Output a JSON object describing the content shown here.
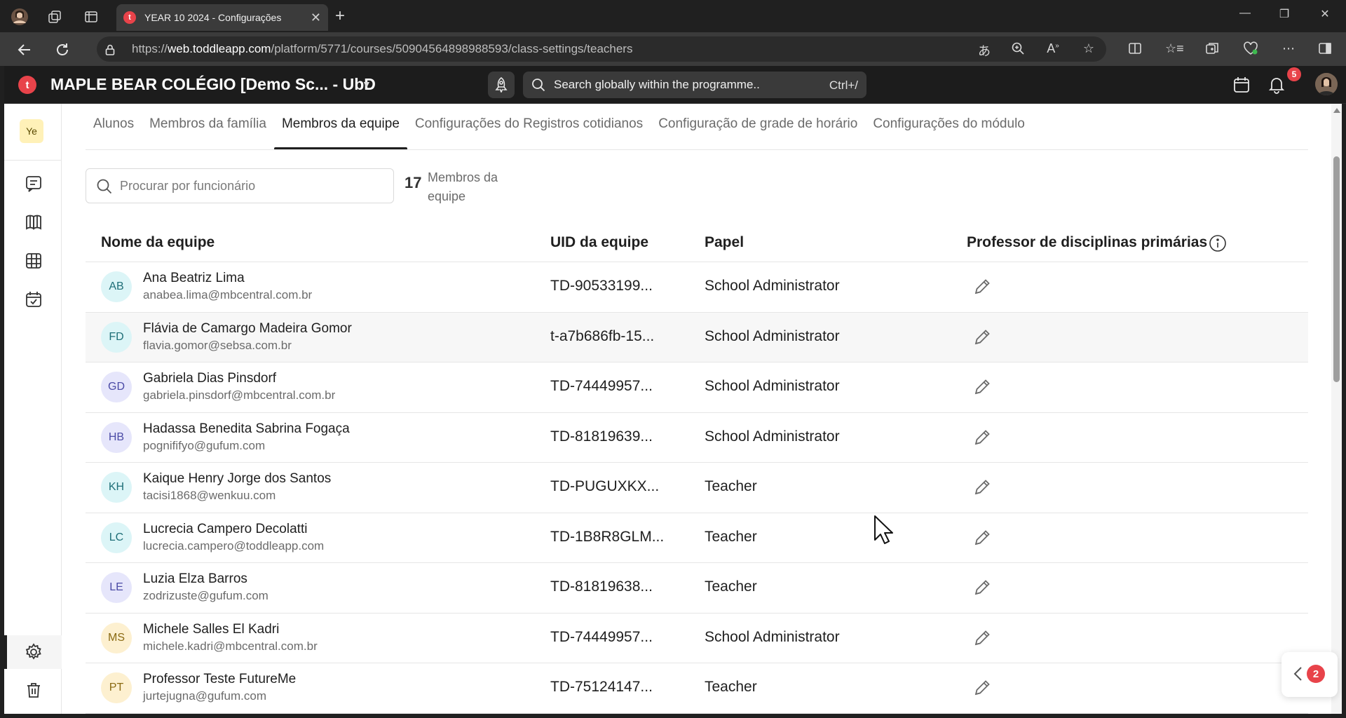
{
  "browser": {
    "tab_title": "YEAR 10 2024 - Configurações",
    "tab_favicon_letter": "t",
    "url_prefix": "https://",
    "url_domain": "web.toddleapp.com",
    "url_path": "/platform/5771/courses/50904564898988593/class-settings/teachers"
  },
  "app": {
    "logo_letter": "t",
    "school_name": "MAPLE BEAR COLÉGIO [Demo Sc... - UbD",
    "search_placeholder": "Search globally within the programme..",
    "search_shortcut": "Ctrl+/",
    "notification_count": "5",
    "accent_color": "#e8434a"
  },
  "sidebar": {
    "course_badge": "Ye",
    "icons": [
      "message-icon",
      "book-icon",
      "grid-icon",
      "calendar-check-icon",
      "settings-icon",
      "trash-icon"
    ]
  },
  "tabs": [
    {
      "label": "Alunos",
      "active": false
    },
    {
      "label": "Membros da família",
      "active": false
    },
    {
      "label": "Membros da equipe",
      "active": true
    },
    {
      "label": "Configurações do Registros cotidianos",
      "active": false
    },
    {
      "label": "Configuração de grade de horário",
      "active": false
    },
    {
      "label": "Configurações do módulo",
      "active": false
    }
  ],
  "staff_search": {
    "placeholder": "Procurar por funcionário",
    "value": ""
  },
  "member_count": {
    "number": "17",
    "label": "Membros da equipe"
  },
  "table": {
    "columns": {
      "name": "Nome da equipe",
      "uid": "UID da equipe",
      "role": "Papel",
      "primary": "Professor de disciplinas primárias"
    },
    "rows": [
      {
        "initials": "AB",
        "name": "Ana Beatriz Lima",
        "email": "anabea.lima@mbcentral.com.br",
        "uid": "TD-90533199...",
        "role": "School Administrator",
        "avatar_bg": "#dcf5f7",
        "avatar_fg": "#1f6f78"
      },
      {
        "initials": "FD",
        "name": "Flávia de Camargo Madeira Gomor",
        "email": "flavia.gomor@sebsa.com.br",
        "uid": "t-a7b686fb-15...",
        "role": "School Administrator",
        "avatar_bg": "#dcf5f7",
        "avatar_fg": "#1f6f78"
      },
      {
        "initials": "GD",
        "name": "Gabriela Dias Pinsdorf",
        "email": "gabriela.pinsdorf@mbcentral.com.br",
        "uid": "TD-74449957...",
        "role": "School Administrator",
        "avatar_bg": "#e6e6fb",
        "avatar_fg": "#4b4ba6"
      },
      {
        "initials": "HB",
        "name": "Hadassa Benedita Sabrina Fogaça",
        "email": "pognififyo@gufum.com",
        "uid": "TD-81819639...",
        "role": "School Administrator",
        "avatar_bg": "#e6e6fb",
        "avatar_fg": "#4b4ba6"
      },
      {
        "initials": "KH",
        "name": "Kaique Henry Jorge dos Santos",
        "email": "tacisi1868@wenkuu.com",
        "uid": "TD-PUGUXKX...",
        "role": "Teacher",
        "avatar_bg": "#dcf5f7",
        "avatar_fg": "#1f6f78"
      },
      {
        "initials": "LC",
        "name": "Lucrecia Campero Decolatti",
        "email": "lucrecia.campero@toddleapp.com",
        "uid": "TD-1B8R8GLM...",
        "role": "Teacher",
        "avatar_bg": "#dcf5f7",
        "avatar_fg": "#1f6f78"
      },
      {
        "initials": "LE",
        "name": "Luzia Elza Barros",
        "email": "zodrizuste@gufum.com",
        "uid": "TD-81819638...",
        "role": "Teacher",
        "avatar_bg": "#e6e6fb",
        "avatar_fg": "#4b4ba6"
      },
      {
        "initials": "MS",
        "name": "Michele Salles El Kadri",
        "email": "michele.kadri@mbcentral.com.br",
        "uid": "TD-74449957...",
        "role": "School Administrator",
        "avatar_bg": "#fdf0d0",
        "avatar_fg": "#8a6a12"
      },
      {
        "initials": "PT",
        "name": "Professor Teste FutureMe",
        "email": "jurtejugna@gufum.com",
        "uid": "TD-75124147...",
        "role": "Teacher",
        "avatar_bg": "#fdf0d0",
        "avatar_fg": "#8a6a12"
      }
    ]
  },
  "floating_widget": {
    "badge_count": "2"
  }
}
